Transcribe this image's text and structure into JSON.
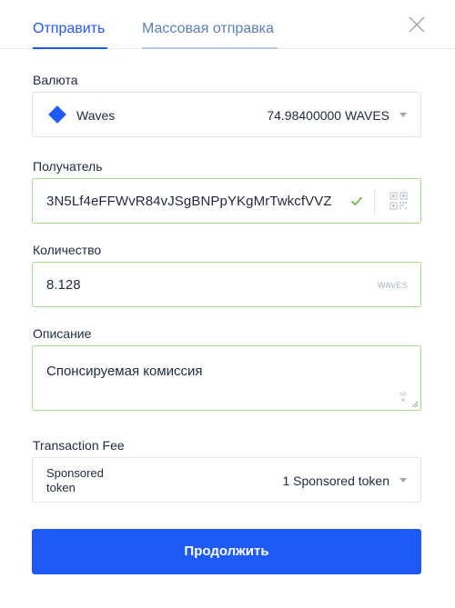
{
  "tabs": {
    "send": "Отправить",
    "mass_send": "Массовая отправка"
  },
  "currency": {
    "label": "Валюта",
    "name": "Waves",
    "balance": "74.98400000 WAVES",
    "icon": "waves-logo-icon"
  },
  "recipient": {
    "label": "Получатель",
    "value": "3N5Lf4eFFWvR84vJSgBNPpYKgMrTwkcfVVZ",
    "valid": true
  },
  "amount": {
    "label": "Количество",
    "value": "8.128",
    "unit": "WAVES"
  },
  "description": {
    "label": "Описание",
    "value": "Спонсируемая комиссия"
  },
  "fee": {
    "label": "Transaction Fee",
    "name": "Sponsored token",
    "value": "1 Sponsored token"
  },
  "actions": {
    "continue": "Продолжить"
  },
  "colors": {
    "accent": "#1f5af6",
    "valid_border": "#a6d98b",
    "check": "#5cb531"
  }
}
